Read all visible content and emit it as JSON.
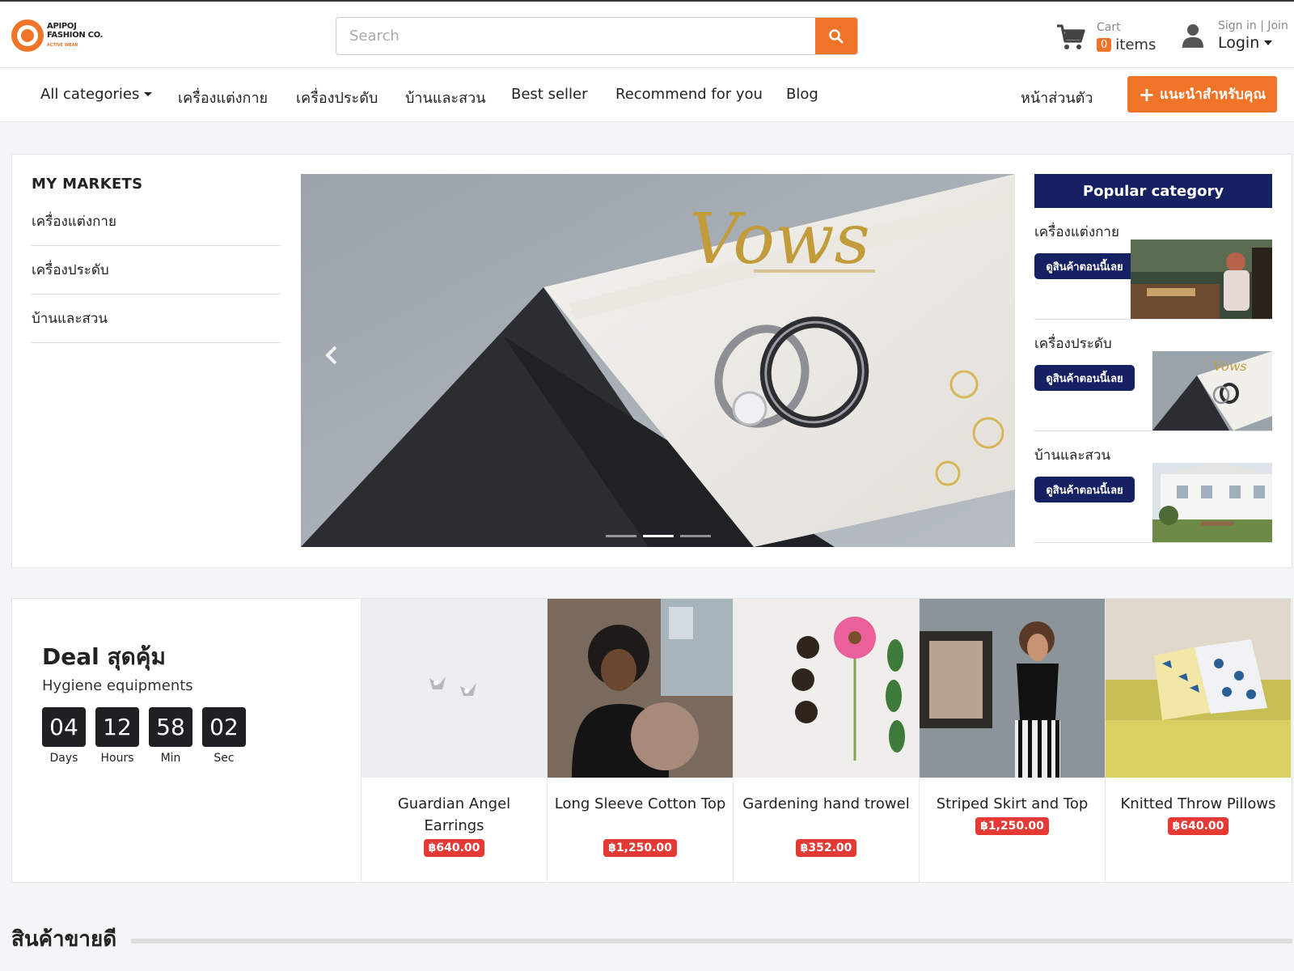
{
  "brand": {
    "line1": "APIPOJ",
    "line2": "FASHION CO.",
    "tagline": "ACTIVE WEAR"
  },
  "search": {
    "placeholder": "Search"
  },
  "cart": {
    "label": "Cart",
    "count": "0",
    "items_label": "items"
  },
  "account": {
    "links": "Sign in | Join",
    "login_label": "Login"
  },
  "nav": {
    "all_categories": "All categories",
    "items": [
      "เครื่องแต่งกาย",
      "เครื่องประดับ",
      "บ้านและสวน",
      "Best seller",
      "Recommend for you",
      "Blog"
    ],
    "profile": "หน้าส่วนตัว",
    "cta": "แนะนำสำหรับคุณ"
  },
  "markets": {
    "title": "MY MARKETS",
    "items": [
      "เครื่องแต่งกาย",
      "เครื่องประดับ",
      "บ้านและสวน"
    ]
  },
  "banner": {
    "slide_count": 3,
    "active_slide": 2,
    "text": "Vows"
  },
  "popular": {
    "title": "Popular category",
    "cards": [
      {
        "label": "เครื่องแต่งกาย",
        "button": "ดูสินค้าตอนนี้เลย"
      },
      {
        "label": "เครื่องประดับ",
        "button": "ดูสินค้าตอนนี้เลย"
      },
      {
        "label": "บ้านและสวน",
        "button": "ดูสินค้าตอนนี้เลย"
      }
    ]
  },
  "deal": {
    "title": "Deal สุดคุ้ม",
    "subtitle": "Hygiene equipments",
    "timer": [
      {
        "value": "04",
        "label": "Days"
      },
      {
        "value": "12",
        "label": "Hours"
      },
      {
        "value": "58",
        "label": "Min"
      },
      {
        "value": "02",
        "label": "Sec"
      }
    ]
  },
  "products": [
    {
      "name": "Guardian Angel Earrings",
      "price": "฿640.00"
    },
    {
      "name": "Long Sleeve Cotton Top",
      "price": "฿1,250.00"
    },
    {
      "name": "Gardening hand trowel",
      "price": "฿352.00"
    },
    {
      "name": "Striped Skirt and Top",
      "price": "฿1,250.00"
    },
    {
      "name": "Knitted Throw Pillows",
      "price": "฿640.00"
    }
  ],
  "bestseller": {
    "title": "สินค้าขายดี"
  },
  "colors": {
    "accent": "#f07427",
    "navy": "#152163",
    "price": "#e53935"
  }
}
